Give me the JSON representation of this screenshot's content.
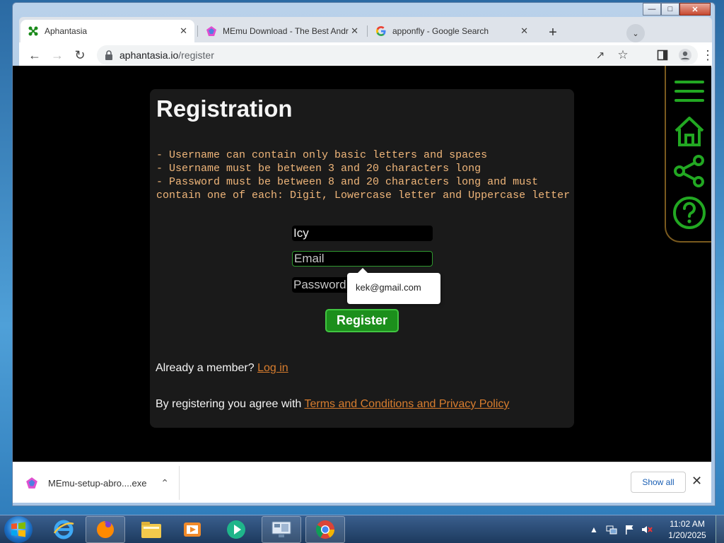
{
  "tabs": [
    {
      "label": "Aphantasia",
      "icon": "aphantasia-icon",
      "active": true
    },
    {
      "label": "MEmu Download - The Best Andr",
      "icon": "memu-icon",
      "active": false
    },
    {
      "label": "apponfly - Google Search",
      "icon": "google-icon",
      "active": false
    }
  ],
  "address_bar": {
    "host": "aphantasia.io",
    "path": "/register"
  },
  "page": {
    "title": "Registration",
    "rules": [
      "- Username can contain only basic letters and spaces",
      "- Username must be between 3 and 20 characters long",
      "- Password must be between 8 and 20 characters long and must",
      "contain one of each: Digit, Lowercase letter and Uppercase letter"
    ],
    "username_value": "Icy",
    "email_placeholder": "Email",
    "password_placeholder": "Password",
    "register_label": "Register",
    "already_member_text": "Already a member?",
    "login_link": "Log in",
    "agree_text": "By registering you agree with",
    "terms_link": "Terms and Conditions and Privacy Policy"
  },
  "autofill": {
    "suggestion": "kek@gmail.com"
  },
  "download_bar": {
    "filename": "MEmu-setup-abro....exe",
    "show_all": "Show all"
  },
  "taskbar": {
    "time": "11:02 AM",
    "date": "1/20/2025"
  },
  "colors": {
    "accent_green": "#1c8f1c",
    "link_orange": "#d87d2e",
    "rules_text": "#f0b67a",
    "sidenav_green": "#22a822"
  }
}
